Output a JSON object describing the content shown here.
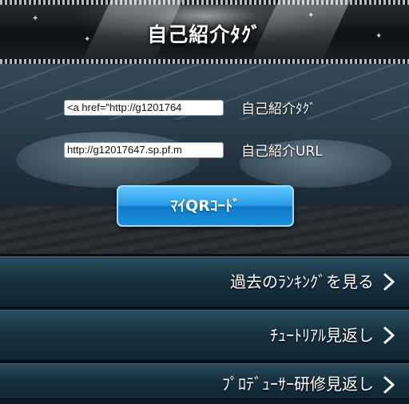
{
  "header": {
    "title": "自己紹介ﾀｸﾞ"
  },
  "fields": [
    {
      "value": "<a href=\"http://g1201764",
      "label": "自己紹介ﾀｸﾞ"
    },
    {
      "value": "http://g12017647.sp.pf.m",
      "label": "自己紹介URL"
    }
  ],
  "qr_button": {
    "label": "ﾏｲQRｺｰﾄﾞ"
  },
  "menu": [
    {
      "label": "過去のﾗﾝｷﾝｸﾞを見る"
    },
    {
      "label": "ﾁｭｰﾄﾘｱﾙ見返し"
    },
    {
      "label": "ﾌﾟﾛﾃﾞｭｰｻｰ研修見返し"
    }
  ],
  "icons": {
    "menu_arrow": "chevron-right-icon"
  },
  "colors": {
    "button_blue": "#2a9de6",
    "menu_bg": "#173241"
  }
}
